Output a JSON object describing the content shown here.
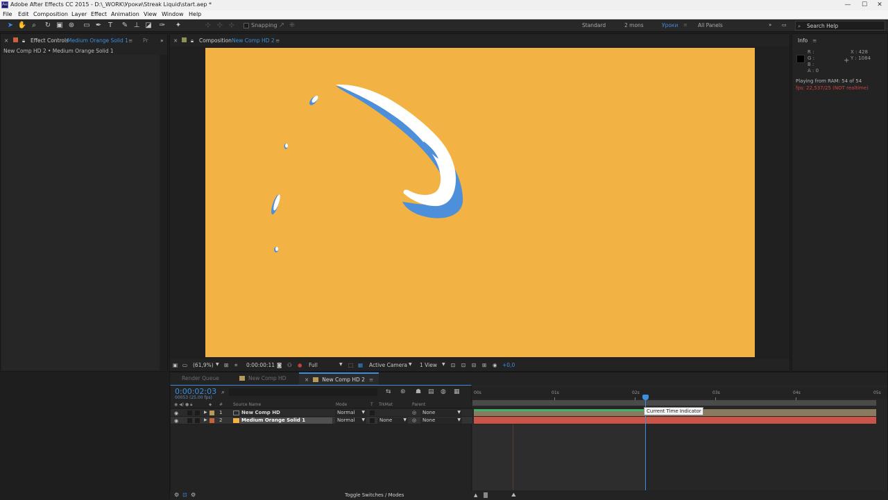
{
  "window": {
    "title": "Adobe After Effects CC 2015 - D:\\_WORK\\Уроки\\Streak Liquid\\start.aep *"
  },
  "menu": [
    "File",
    "Edit",
    "Composition",
    "Layer",
    "Effect",
    "Animation",
    "View",
    "Window",
    "Help"
  ],
  "toolbar": {
    "snapping_label": "Snapping",
    "workspaces": [
      "Standard",
      "2 mons",
      "Уроки",
      "All Panels"
    ],
    "active_workspace": "Уроки",
    "search_placeholder": "Search Help"
  },
  "effect_controls": {
    "tab_label": "Effect Controls",
    "layer_name": "Medium Orange Solid 1",
    "project_tab_abbr": "Pr",
    "breadcrumb": "New Comp HD 2 • Medium Orange Solid 1"
  },
  "composition": {
    "tab_label": "Composition",
    "comp_name": "New Comp HD 2",
    "canvas_color": "#f3b344",
    "splash_colors": {
      "white": "#ffffff",
      "blue": "#4d8fd9"
    },
    "viewer_bar": {
      "zoom": "(61,9%)",
      "timecode": "0:00:00:11",
      "resolution": "Full",
      "camera": "Active Camera",
      "views": "1 View",
      "exposure": "+0,0"
    }
  },
  "info": {
    "title": "Info",
    "r": "R :",
    "g": "G :",
    "b": "B :",
    "a": "A : 0",
    "x": "X : 428",
    "y": "Y : 1084",
    "playing": "Playing from RAM: 54 of 54",
    "fps": "fps: 22,537/25 (NOT realtime)"
  },
  "timeline": {
    "tabs": [
      "Render Queue",
      "New Comp HD",
      "New Comp HD 2"
    ],
    "active_tab": "New Comp HD 2",
    "current_time": "0:00:02:03",
    "frames": "00053 (25.00 fps)",
    "columns": {
      "hash": "#",
      "source": "Source Name",
      "mode": "Mode",
      "t": "T",
      "trkmat": "TrkMat",
      "parent": "Parent"
    },
    "layers": [
      {
        "num": "1",
        "name": "New Comp HD",
        "mode": "Normal",
        "trkmat": "",
        "parent": "None",
        "color": "#b59a59",
        "bar_color": "#8a7a5f"
      },
      {
        "num": "2",
        "name": "Medium Orange Solid 1",
        "mode": "Normal",
        "trkmat": "None",
        "parent": "None",
        "color": "#c8623a",
        "bar_color": "#c85548"
      }
    ],
    "ruler_labels": [
      "00s",
      "01s",
      "02s",
      "03s",
      "04s",
      "05s"
    ],
    "toggle_label": "Toggle Switches / Modes",
    "tooltip": "Current Time Indicator"
  }
}
